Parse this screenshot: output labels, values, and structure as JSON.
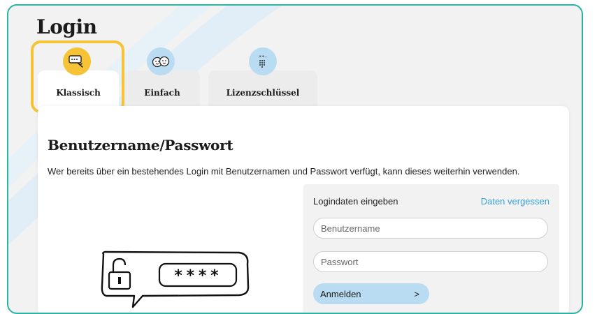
{
  "page": {
    "title": "Login"
  },
  "tabs": [
    {
      "label": "Klassisch",
      "icon": "key-card-icon",
      "active": true
    },
    {
      "label": "Einfach",
      "icon": "faces-icon",
      "active": false
    },
    {
      "label": "Lizenzschlüssel",
      "icon": "keypad-icon",
      "active": false
    }
  ],
  "content": {
    "heading": "Benutzername/Passwort",
    "description": "Wer bereits über ein bestehendes Login mit Benutzernamen und Passwort verfügt, kann dieses weiterhin verwenden."
  },
  "login_panel": {
    "title": "Logindaten eingeben",
    "forgot_link": "Daten vergessen",
    "username_placeholder": "Benutzername",
    "password_placeholder": "Passwort",
    "submit_label": "Anmelden",
    "submit_chevron": ">"
  },
  "illustration": {
    "password_mask": "****"
  },
  "colors": {
    "accent_teal": "#2bb3a3",
    "highlight_yellow": "#f6c337",
    "link_blue": "#3a9fd8",
    "button_blue": "#b9dcf3"
  }
}
